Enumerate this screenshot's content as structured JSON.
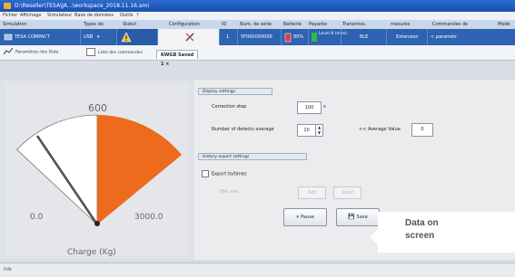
{
  "window": {
    "title": "D:\\Reseller\\TESA\\JA...\\workspace_2018.11.16.ami"
  },
  "menu": [
    "Fichier",
    "Affichage",
    "Simulateur",
    "Base de données",
    "Outils",
    "?"
  ],
  "device_table": {
    "headers": [
      "Simulation",
      "Types de",
      "Statut",
      "Configuration",
      "ID",
      "Num. de série",
      "Batterie",
      "Payante",
      "Transmiss.",
      "mesures",
      "Commandes de",
      "Mode"
    ],
    "row": {
      "name": "TESA COMPACT",
      "type": "USB",
      "id": "1",
      "serial": "5F000000000",
      "battery": "80%",
      "signal": "Level 8 (max)",
      "transmission": "BLE",
      "measures": "Extension",
      "commands": "< paramètr."
    }
  },
  "toolbar": {
    "params_label": "Paramètres des Data",
    "list_label": "Liste des commandes",
    "doc_tab_label": "KWGB Saved 1 ×"
  },
  "gauge": {
    "value": 0,
    "min_label": "0.0",
    "max_label": "3000.0",
    "top_label": "600",
    "unit_label": "Charge (Kg)",
    "fill_color": "#ee6a1d"
  },
  "display_settings": {
    "title": "Display settings",
    "correction_step_label": "Correction step",
    "correction_step_value": "100",
    "correction_step_unit": "s",
    "nb_detects_label": "Number of detects average",
    "nb_detects_value": "10",
    "average_label": "<< Average Value",
    "average_value": "0"
  },
  "history": {
    "title": "History export settings",
    "export_label": "Export to/times",
    "file_label": "File: xxx",
    "btn_add": "Add",
    "btn_send": "Send",
    "btn_pause": "Pause",
    "btn_save": "Save"
  },
  "callout": {
    "line1": "Data on",
    "line2": "screen"
  },
  "status": {
    "text": "Prêt"
  }
}
